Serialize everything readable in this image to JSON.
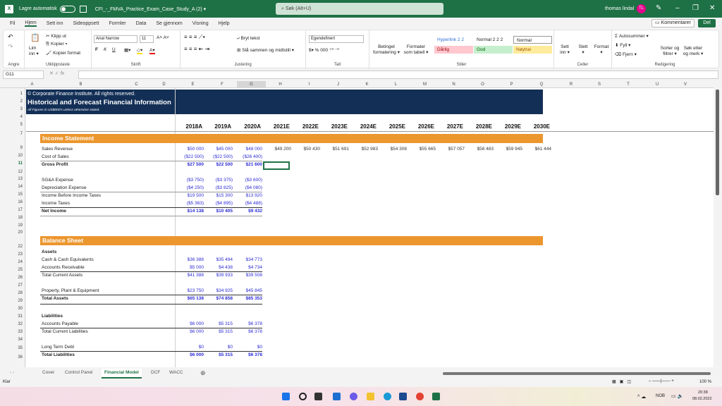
{
  "titlebar": {
    "autosave_label": "Lagre automatisk",
    "document_title": "CFI_-_FMVA_Practice_Exam_Case_Study_A (2) ▾",
    "search_placeholder": "Søk (Alt+U)",
    "user_name": "thomas lindal",
    "user_initials": "TL"
  },
  "menu": [
    "Fil",
    "Hjem",
    "Sett inn",
    "Sideoppsett",
    "Formler",
    "Data",
    "Se gjennom",
    "Visning",
    "Hjelp"
  ],
  "menu_active": "Hjem",
  "header_buttons": {
    "comments": "Kommentarer",
    "share": "Del"
  },
  "ribbon": {
    "undo_group": "Angre",
    "clipboard": {
      "paste": "Lim inn ▾",
      "cut": "Klipp ut",
      "copy": "Kopier ▾",
      "format_painter": "Kopier format",
      "label": "Utklippstavle"
    },
    "font": {
      "name": "Arial Narrow",
      "size": "11",
      "bold": "F",
      "italic": "K",
      "underline": "U",
      "label": "Skrift"
    },
    "alignment": {
      "wrap": "Bryt tekst",
      "merge": "Slå sammen og midtstill ▾",
      "label": "Justering"
    },
    "number": {
      "format": "Egendefinert",
      "label": "Tall"
    },
    "styles": {
      "conditional": "Betinget formatering ▾",
      "as_table": "Formater som tabell ▾",
      "label": "Stiler",
      "cells": [
        {
          "name": "Hyperlink 2 2",
          "bg": "#ffffff",
          "fg": "#2f6fd6"
        },
        {
          "name": "Normal 2 2 2",
          "bg": "#ffffff",
          "fg": "#222222"
        },
        {
          "name": "Normal",
          "bg": "#ffffff",
          "fg": "#222222"
        },
        {
          "name": "Dårlig",
          "bg": "#ffc7ce",
          "fg": "#9c0006"
        },
        {
          "name": "God",
          "bg": "#c6efce",
          "fg": "#006100"
        },
        {
          "name": "Nøytral",
          "bg": "#ffeb9c",
          "fg": "#9c5700"
        }
      ]
    },
    "cells": {
      "insert": "Sett inn ▾",
      "delete": "Slett ▾",
      "format": "Format ▾",
      "label": "Celler"
    },
    "editing": {
      "autosum": "Autosummer ▾",
      "fill": "Fyll ▾",
      "clear": "Fjern ▾",
      "sort": "Sorter og filtrer ▾",
      "find": "Søk etter og merk ▾",
      "label": "Redigering"
    }
  },
  "formula_bar": {
    "name_box": "G11",
    "fx": "fx",
    "formula": ""
  },
  "columns": [
    "A",
    "B",
    "C",
    "D",
    "E",
    "F",
    "G",
    "H",
    "I",
    "J",
    "K",
    "L",
    "M",
    "N",
    "O",
    "P",
    "Q",
    "R",
    "S",
    "T",
    "U",
    "V"
  ],
  "selected_column": "G",
  "rows": [
    "1",
    "2",
    "3",
    "4",
    "5",
    "7",
    "9",
    "10",
    "11",
    "12",
    "13",
    "14",
    "15",
    "16",
    "17",
    "18",
    "19",
    "20",
    "22",
    "23",
    "24",
    "25",
    "26",
    "27",
    "28",
    "29",
    "30",
    "31",
    "32",
    "33",
    "34",
    "35",
    "36"
  ],
  "sheet": {
    "banner": {
      "copyright": "© Corporate Finance Institute. All rights reserved.",
      "title": "Historical and Forecast Financial Information",
      "subtitle": "All Figures in US$000's unless otherwise stated."
    },
    "years": [
      "2018A",
      "2019A",
      "2020A",
      "2021E",
      "2022E",
      "2023E",
      "2024E",
      "2025E",
      "2026E",
      "2027E",
      "2028E",
      "2029E",
      "2030E"
    ],
    "income_statement": {
      "title": "Income Statement",
      "rows": [
        {
          "label": "Sales Revenue",
          "values": [
            "$50 000",
            "$45 000",
            "$48 000"
          ],
          "forecast": [
            "$49 200",
            "$50 430",
            "$51 691",
            "$52 983",
            "$54 308",
            "$55 665",
            "$57 057",
            "$58 483",
            "$59 945",
            "$61 444"
          ]
        },
        {
          "label": "Cost of Sales",
          "values": [
            "($22 500)",
            "($22 500)",
            "($26 400)"
          ]
        },
        {
          "label": "Gross Profit",
          "values": [
            "$27 500",
            "$22 500",
            "$21 600"
          ],
          "bold": true
        },
        {
          "label": "SG&A Expense",
          "values": [
            "($3 750)",
            "($3 375)",
            "($3 600)"
          ]
        },
        {
          "label": "Depreciation Expense",
          "values": [
            "($4 250)",
            "($3 825)",
            "($4 080)"
          ]
        },
        {
          "label": "Income Before Income Taxes",
          "values": [
            "$19 500",
            "$15 300",
            "$13 920"
          ]
        },
        {
          "label": "Income Taxes",
          "values": [
            "($5 363)",
            "($4 895)",
            "($4 488)"
          ]
        },
        {
          "label": "Net Income",
          "values": [
            "$14 138",
            "$10 405",
            "$9 432"
          ],
          "bold": true
        }
      ]
    },
    "balance_sheet": {
      "title": "Balance Sheet",
      "assets_header": "Assets",
      "rows": [
        {
          "label": "Cash & Cash Equivalents",
          "values": [
            "$36 388",
            "$35 494",
            "$34 773"
          ]
        },
        {
          "label": "Accounts Receivable",
          "values": [
            "$5 000",
            "$4 438",
            "$4 734"
          ]
        },
        {
          "label": "Total Current Assets",
          "values": [
            "$41 388",
            "$39 933",
            "$39 508"
          ]
        },
        {
          "label": "Property, Plant & Equipment",
          "values": [
            "$23 750",
            "$34 925",
            "$45 845"
          ]
        },
        {
          "label": "Total Assets",
          "values": [
            "$65 138",
            "$74 858",
            "$85 353"
          ],
          "bold": true
        }
      ],
      "liabilities_header": "Liabilities",
      "liab_rows": [
        {
          "label": "Accounts Payable",
          "values": [
            "$6 000",
            "$5 315",
            "$6 378"
          ]
        },
        {
          "label": "Total Current Liabilities",
          "values": [
            "$6 000",
            "$5 315",
            "$6 378"
          ]
        },
        {
          "label": "Long Term Debt",
          "values": [
            "$0",
            "$0",
            "$0"
          ]
        },
        {
          "label": "Total Liabilities",
          "values": [
            "$6 000",
            "$5 315",
            "$6 378"
          ],
          "bold": true
        }
      ]
    }
  },
  "sheet_tabs": [
    "Cover",
    "Control Panel",
    "Financial Model",
    "DCF",
    "WACC"
  ],
  "active_tab": "Financial Model",
  "status": {
    "ready": "Klar",
    "zoom": "100 %"
  },
  "taskbar": {
    "lang": "NOB",
    "time": "20:38",
    "date": "08.02.2022"
  },
  "colors": {
    "excel_green": "#1e7145",
    "banner_navy": "#132f56",
    "section_orange": "#ec962e",
    "input_blue": "#2b2bd6"
  }
}
